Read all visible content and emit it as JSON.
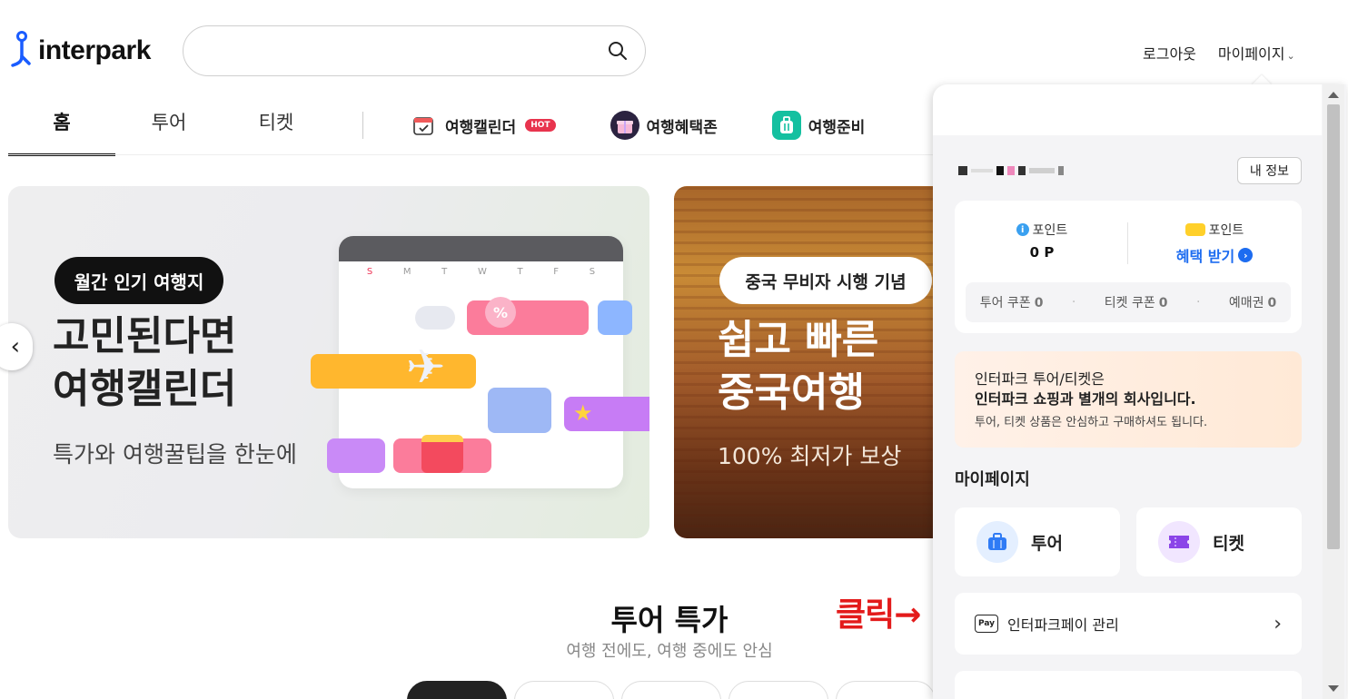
{
  "header": {
    "brand": "interpark",
    "search_placeholder": "",
    "logout_label": "로그아웃",
    "mypage_label": "마이페이지"
  },
  "nav": {
    "tabs": [
      {
        "label": "홈",
        "active": true
      },
      {
        "label": "투어",
        "active": false
      },
      {
        "label": "티켓",
        "active": false
      }
    ],
    "specials": [
      {
        "label": "여행캘린더",
        "badge": "HOT"
      },
      {
        "label": "여행혜택존"
      },
      {
        "label": "여행준비"
      }
    ]
  },
  "banners": [
    {
      "tag": "월간 인기 여행지",
      "title_line1": "고민된다면",
      "title_line2": "여행캘린더",
      "subtitle": "특가와 여행꿀팁을 한눈에",
      "calendar_days": [
        "S",
        "M",
        "T",
        "W",
        "T",
        "F",
        "S"
      ]
    },
    {
      "tag": "중국 무비자 시행 기념",
      "title_line1": "쉽고 빠른",
      "title_line2": "중국여행",
      "subtitle": "100% 최저가 보상"
    }
  ],
  "section": {
    "title": "투어 특가",
    "subtitle": "여행 전에도, 여행 중에도 안심"
  },
  "annotation": {
    "text": "클릭→"
  },
  "mypage_panel": {
    "my_info_button": "내 정보",
    "points": {
      "i_point_label": "포인트",
      "i_point_value": "0 P",
      "partner_point_label": "포인트",
      "benefit_label": "혜택 받기"
    },
    "coupons": [
      {
        "label": "투어 쿠폰",
        "count": "0"
      },
      {
        "label": "티켓 쿠폰",
        "count": "0"
      },
      {
        "label": "예매권",
        "count": "0"
      }
    ],
    "notice": {
      "line1": "인터파크 투어/티켓은",
      "line2": "인터파크 쇼핑과 별개의 회사입니다.",
      "line3": "투어, 티켓 상품은 안심하고 구매하셔도 됩니다."
    },
    "section_title": "마이페이지",
    "categories": [
      {
        "label": "투어",
        "icon": "suitcase-icon",
        "color": "#2f7bf5"
      },
      {
        "label": "티켓",
        "icon": "ticket-icon",
        "color": "#8b45e8"
      }
    ],
    "pay_item": {
      "icon_text": "Pay",
      "label": "인터파크페이 관리"
    }
  },
  "colors": {
    "accent_blue": "#1d6cf0",
    "hot_badge": "#e8344e",
    "annotation_red": "#e31b1b"
  }
}
